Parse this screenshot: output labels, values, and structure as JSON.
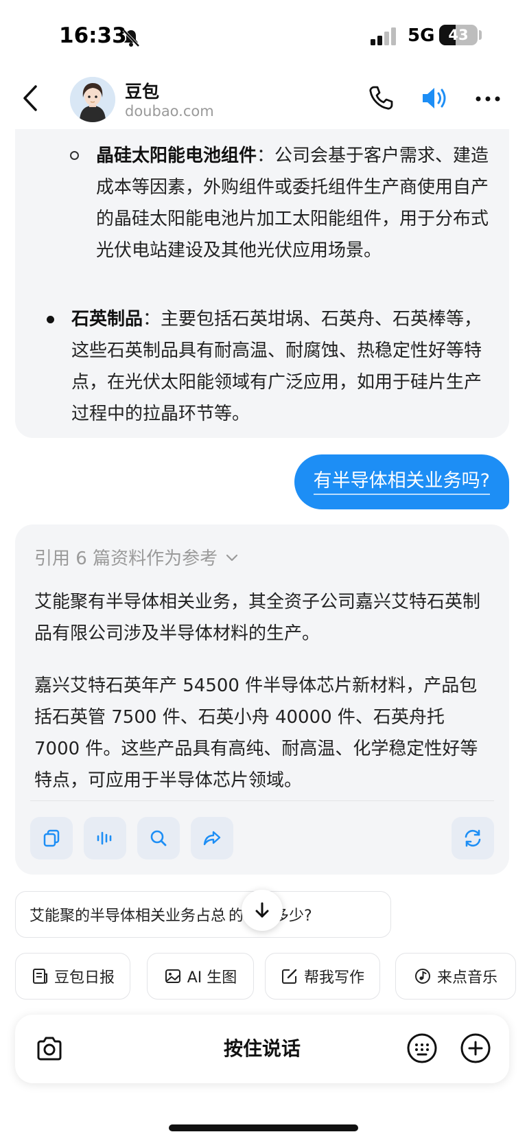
{
  "status_bar": {
    "time": "16:33",
    "network": "5G",
    "battery": "43",
    "battery_level": 0.43
  },
  "header": {
    "bot_name": "豆包",
    "bot_domain": "doubao.com"
  },
  "previous_message": {
    "sub_item": {
      "title": "晶硅太阳能电池组件",
      "text": "：公司会基于客户需求、建造成本等因素，外购组件或委托组件生产商使用自产的晶硅太阳能电池片加工太阳能组件，用于分布式光伏电站建设及其他光伏应用场景。"
    },
    "main_item": {
      "title": "石英制品",
      "text": "：主要包括石英坩埚、石英舟、石英棒等，这些石英制品具有耐高温、耐腐蚀、热稳定性好等特点，在光伏太阳能领域有广泛应用，如用于硅片生产过程中的拉晶环节等。"
    }
  },
  "user_message": {
    "text": "有半导体相关业务吗?"
  },
  "answer": {
    "reference_label": "引用 6 篇资料作为参考",
    "paragraph1": "艾能聚有半导体相关业务，其全资子公司嘉兴艾特石英制品有限公司涉及半导体材料的生产。",
    "paragraph2": "嘉兴艾特石英年产 54500 件半导体芯片新材料，产品包括石英管 7500 件、石英小舟 40000 件、石英舟托 7000 件。这些产品具有高纯、耐高温、化学稳定性好等特点，可应用于半导体芯片领域。",
    "actions": [
      "copy-icon",
      "voice-wave-icon",
      "search-icon",
      "share-icon",
      "regenerate-icon"
    ]
  },
  "suggestion": {
    "left": "艾能聚的半导体相关业务占总",
    "right": "的比例多少?"
  },
  "quick_actions": [
    {
      "icon": "daily-report-icon",
      "label": "豆包日报"
    },
    {
      "icon": "image-icon",
      "label": "AI 生图"
    },
    {
      "icon": "edit-icon",
      "label": "帮我写作"
    },
    {
      "icon": "music-icon",
      "label": "来点音乐"
    }
  ],
  "input_bar": {
    "hold_to_talk": "按住说话"
  },
  "colors": {
    "accent": "#1d8ef5",
    "bubble_bg": "#f4f5f7",
    "muted": "#9a9a9a"
  }
}
